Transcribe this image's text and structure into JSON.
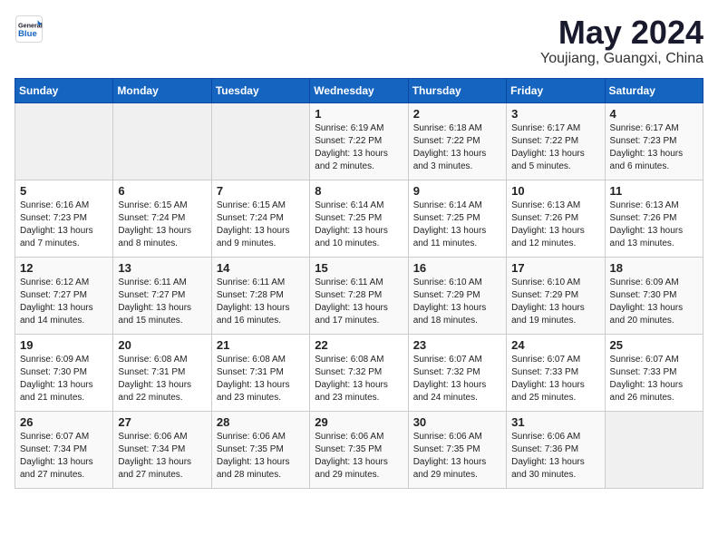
{
  "header": {
    "logo_line1": "General",
    "logo_line2": "Blue",
    "month": "May 2024",
    "location": "Youjiang, Guangxi, China"
  },
  "weekdays": [
    "Sunday",
    "Monday",
    "Tuesday",
    "Wednesday",
    "Thursday",
    "Friday",
    "Saturday"
  ],
  "weeks": [
    [
      {
        "day": "",
        "info": ""
      },
      {
        "day": "",
        "info": ""
      },
      {
        "day": "",
        "info": ""
      },
      {
        "day": "1",
        "info": "Sunrise: 6:19 AM\nSunset: 7:22 PM\nDaylight: 13 hours and 2 minutes."
      },
      {
        "day": "2",
        "info": "Sunrise: 6:18 AM\nSunset: 7:22 PM\nDaylight: 13 hours and 3 minutes."
      },
      {
        "day": "3",
        "info": "Sunrise: 6:17 AM\nSunset: 7:22 PM\nDaylight: 13 hours and 5 minutes."
      },
      {
        "day": "4",
        "info": "Sunrise: 6:17 AM\nSunset: 7:23 PM\nDaylight: 13 hours and 6 minutes."
      }
    ],
    [
      {
        "day": "5",
        "info": "Sunrise: 6:16 AM\nSunset: 7:23 PM\nDaylight: 13 hours and 7 minutes."
      },
      {
        "day": "6",
        "info": "Sunrise: 6:15 AM\nSunset: 7:24 PM\nDaylight: 13 hours and 8 minutes."
      },
      {
        "day": "7",
        "info": "Sunrise: 6:15 AM\nSunset: 7:24 PM\nDaylight: 13 hours and 9 minutes."
      },
      {
        "day": "8",
        "info": "Sunrise: 6:14 AM\nSunset: 7:25 PM\nDaylight: 13 hours and 10 minutes."
      },
      {
        "day": "9",
        "info": "Sunrise: 6:14 AM\nSunset: 7:25 PM\nDaylight: 13 hours and 11 minutes."
      },
      {
        "day": "10",
        "info": "Sunrise: 6:13 AM\nSunset: 7:26 PM\nDaylight: 13 hours and 12 minutes."
      },
      {
        "day": "11",
        "info": "Sunrise: 6:13 AM\nSunset: 7:26 PM\nDaylight: 13 hours and 13 minutes."
      }
    ],
    [
      {
        "day": "12",
        "info": "Sunrise: 6:12 AM\nSunset: 7:27 PM\nDaylight: 13 hours and 14 minutes."
      },
      {
        "day": "13",
        "info": "Sunrise: 6:11 AM\nSunset: 7:27 PM\nDaylight: 13 hours and 15 minutes."
      },
      {
        "day": "14",
        "info": "Sunrise: 6:11 AM\nSunset: 7:28 PM\nDaylight: 13 hours and 16 minutes."
      },
      {
        "day": "15",
        "info": "Sunrise: 6:11 AM\nSunset: 7:28 PM\nDaylight: 13 hours and 17 minutes."
      },
      {
        "day": "16",
        "info": "Sunrise: 6:10 AM\nSunset: 7:29 PM\nDaylight: 13 hours and 18 minutes."
      },
      {
        "day": "17",
        "info": "Sunrise: 6:10 AM\nSunset: 7:29 PM\nDaylight: 13 hours and 19 minutes."
      },
      {
        "day": "18",
        "info": "Sunrise: 6:09 AM\nSunset: 7:30 PM\nDaylight: 13 hours and 20 minutes."
      }
    ],
    [
      {
        "day": "19",
        "info": "Sunrise: 6:09 AM\nSunset: 7:30 PM\nDaylight: 13 hours and 21 minutes."
      },
      {
        "day": "20",
        "info": "Sunrise: 6:08 AM\nSunset: 7:31 PM\nDaylight: 13 hours and 22 minutes."
      },
      {
        "day": "21",
        "info": "Sunrise: 6:08 AM\nSunset: 7:31 PM\nDaylight: 13 hours and 23 minutes."
      },
      {
        "day": "22",
        "info": "Sunrise: 6:08 AM\nSunset: 7:32 PM\nDaylight: 13 hours and 23 minutes."
      },
      {
        "day": "23",
        "info": "Sunrise: 6:07 AM\nSunset: 7:32 PM\nDaylight: 13 hours and 24 minutes."
      },
      {
        "day": "24",
        "info": "Sunrise: 6:07 AM\nSunset: 7:33 PM\nDaylight: 13 hours and 25 minutes."
      },
      {
        "day": "25",
        "info": "Sunrise: 6:07 AM\nSunset: 7:33 PM\nDaylight: 13 hours and 26 minutes."
      }
    ],
    [
      {
        "day": "26",
        "info": "Sunrise: 6:07 AM\nSunset: 7:34 PM\nDaylight: 13 hours and 27 minutes."
      },
      {
        "day": "27",
        "info": "Sunrise: 6:06 AM\nSunset: 7:34 PM\nDaylight: 13 hours and 27 minutes."
      },
      {
        "day": "28",
        "info": "Sunrise: 6:06 AM\nSunset: 7:35 PM\nDaylight: 13 hours and 28 minutes."
      },
      {
        "day": "29",
        "info": "Sunrise: 6:06 AM\nSunset: 7:35 PM\nDaylight: 13 hours and 29 minutes."
      },
      {
        "day": "30",
        "info": "Sunrise: 6:06 AM\nSunset: 7:35 PM\nDaylight: 13 hours and 29 minutes."
      },
      {
        "day": "31",
        "info": "Sunrise: 6:06 AM\nSunset: 7:36 PM\nDaylight: 13 hours and 30 minutes."
      },
      {
        "day": "",
        "info": ""
      }
    ]
  ]
}
